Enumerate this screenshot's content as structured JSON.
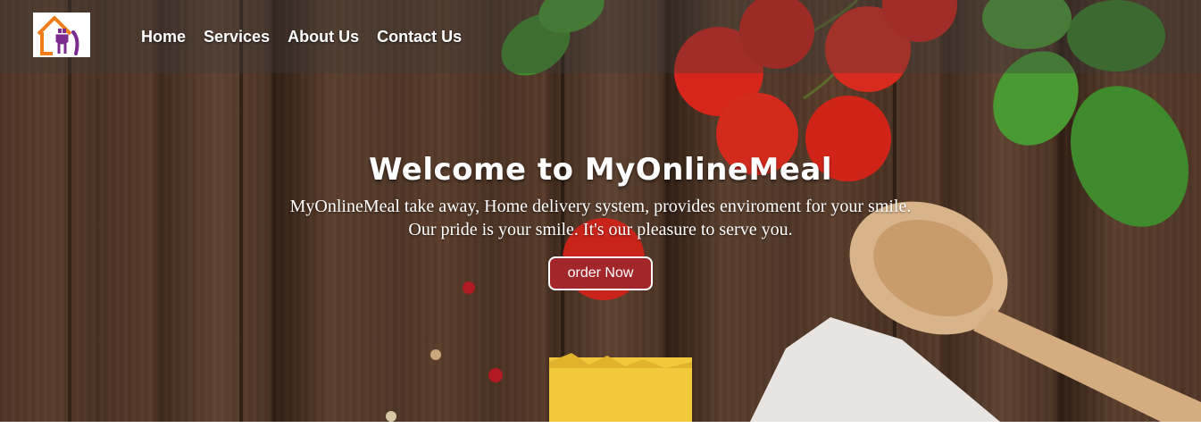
{
  "brand": {
    "logo_icon": "house-fork-knife-icon",
    "colors": {
      "house": "#f07d16",
      "utensils": "#7b2c8e"
    }
  },
  "nav": {
    "items": [
      {
        "label": "Home"
      },
      {
        "label": "Services"
      },
      {
        "label": "About Us"
      },
      {
        "label": "Contact Us"
      }
    ]
  },
  "hero": {
    "title": "Welcome to MyOnlineMeal",
    "line1": "MyOnlineMeal take away, Home delivery system, provides enviroment for your smile.",
    "line2": "Our pride is your smile. It's our pleasure to serve you.",
    "cta_label": "order Now",
    "cta_color": "#a3262a",
    "background": "wood-table-with-tomatoes-basil-spoon-pasta"
  }
}
